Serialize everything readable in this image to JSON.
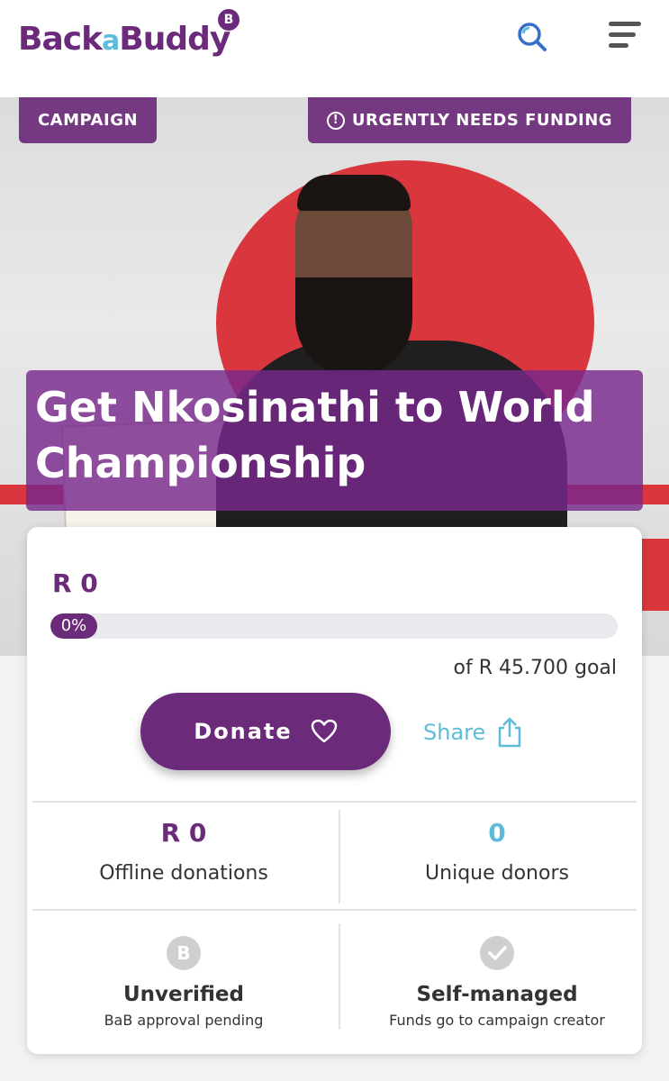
{
  "header": {
    "logo_back": "Back",
    "logo_a": "a",
    "logo_buddy": "Buddy",
    "logo_badge": "B"
  },
  "hero": {
    "tag_campaign": "CAMPAIGN",
    "tag_urgent_icon": "!",
    "tag_urgent": "URGENTLY NEEDS FUNDING",
    "title": "Get Nkosinathi to World Championship"
  },
  "card": {
    "raised": "R 0",
    "progress_label": "0%",
    "progress_value": 0,
    "goal": "of R 45.700 goal",
    "donate_label": "Donate",
    "share_label": "Share"
  },
  "stats": [
    {
      "value": "R 0",
      "label": "Offline donations",
      "color": "#6b2a7a"
    },
    {
      "value": "0",
      "label": "Unique donors",
      "color": "#5fbcd8"
    }
  ],
  "badges": [
    {
      "icon_text": "B",
      "icon": "b-badge-icon",
      "title": "Unverified",
      "subtitle": "BaB approval pending"
    },
    {
      "icon": "checkmark-icon",
      "title": "Self-managed",
      "subtitle": "Funds go to campaign creator"
    }
  ],
  "colors": {
    "brand_purple": "#6b2a7a",
    "accent_blue": "#5fbcd8"
  }
}
